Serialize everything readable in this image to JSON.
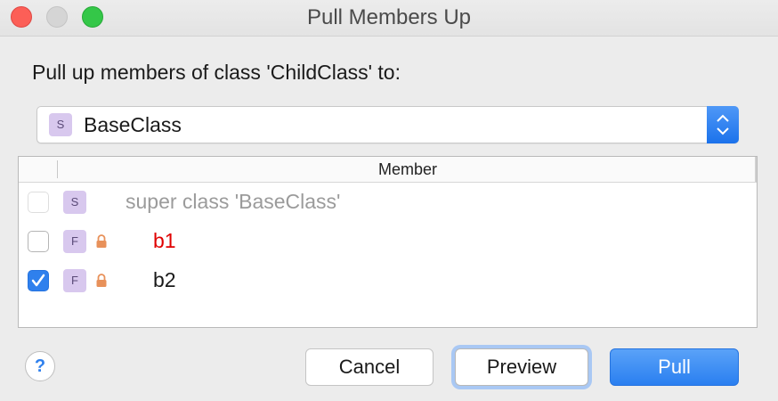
{
  "window": {
    "title": "Pull Members Up"
  },
  "prompt": "Pull up members of class 'ChildClass' to:",
  "target_class": {
    "badge": "S",
    "value": "BaseClass"
  },
  "table": {
    "header": "Member",
    "rows": [
      {
        "checked": false,
        "enabled": false,
        "badge": "S",
        "locked": false,
        "label": "super class 'BaseClass'",
        "color": "#9b9b9b"
      },
      {
        "checked": false,
        "enabled": true,
        "badge": "F",
        "locked": true,
        "label": "b1",
        "color": "#e00000"
      },
      {
        "checked": true,
        "enabled": true,
        "badge": "F",
        "locked": true,
        "label": "b2",
        "color": "#1a1a1a"
      }
    ]
  },
  "buttons": {
    "help": "?",
    "cancel": "Cancel",
    "preview": "Preview",
    "pull": "Pull"
  },
  "icons": {
    "close": "close-traffic-light",
    "minimize": "minimize-traffic-light",
    "maximize": "maximize-traffic-light",
    "combo_arrows": "chevron-up-down-icon",
    "lock": "lock-icon",
    "check": "checkmark-icon"
  },
  "colors": {
    "accent": "#2f80ed",
    "badge_bg": "#d8c8ee"
  }
}
